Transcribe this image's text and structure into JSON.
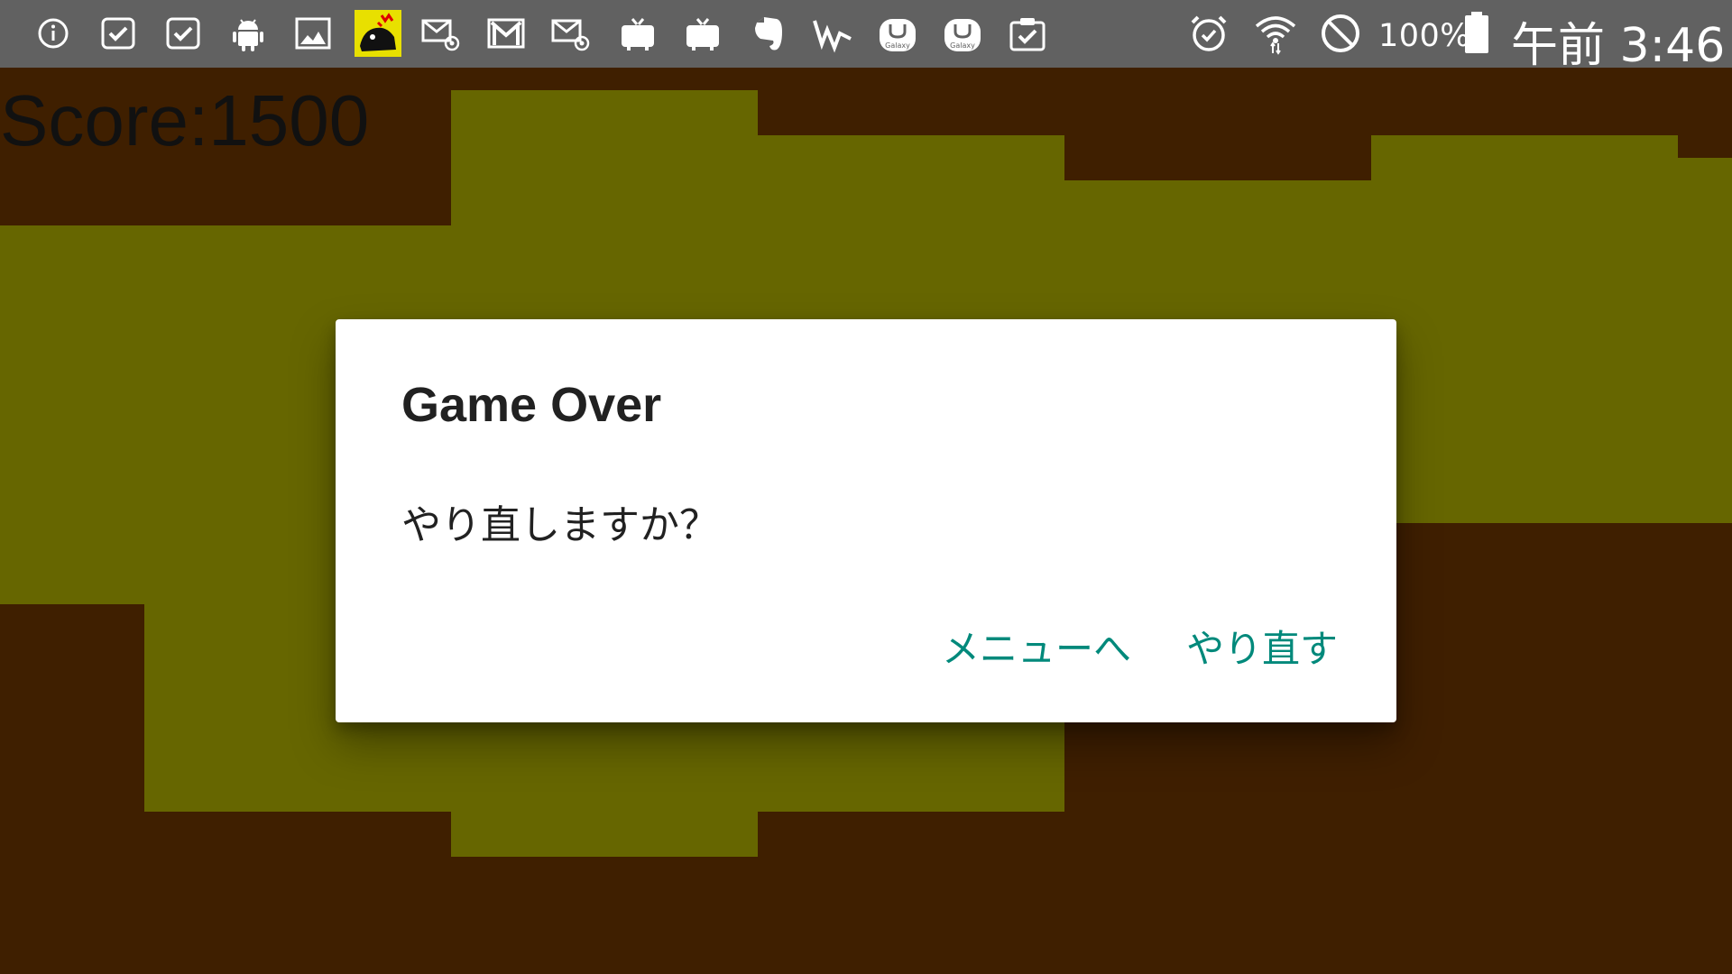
{
  "status_bar": {
    "left_icons": [
      "info-icon",
      "checkbox-icon",
      "checkbox-icon",
      "android-icon",
      "image-icon",
      "app-game-icon",
      "email-at-icon",
      "gmail-icon",
      "email-at-icon",
      "tv-icon",
      "tv-icon",
      "evernote-icon",
      "signal-app-icon",
      "galaxy-apps-icon",
      "galaxy-apps-icon",
      "clipboard-check-icon"
    ],
    "galaxy_label": "Galaxy",
    "right_icons": [
      "alarm-icon",
      "wifi-icon",
      "do-not-disturb-icon",
      "battery-icon"
    ],
    "battery": "100%",
    "clock": "午前 3:46"
  },
  "game": {
    "score": "Score:1500",
    "colors": {
      "rock": "#3f1f00",
      "tunnel": "#666600"
    }
  },
  "dialog": {
    "title": "Game Over",
    "message": "やり直しますか？",
    "buttons": {
      "menu": "メニューへ",
      "retry": "やり直す"
    },
    "accent_color": "#00897b"
  }
}
